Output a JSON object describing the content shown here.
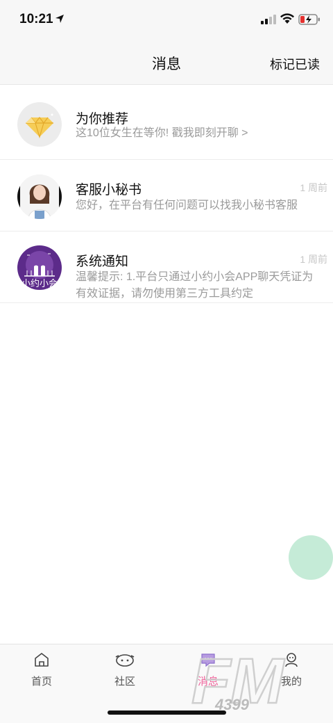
{
  "status_bar": {
    "time": "10:21"
  },
  "nav": {
    "title": "消息",
    "mark_read": "标记已读"
  },
  "messages": [
    {
      "name": "为你推荐",
      "preview": "这10位女生在等你! 戳我即刻开聊 >",
      "time": ""
    },
    {
      "name": "客服小秘书",
      "preview": "您好，在平台有任何问题可以找我小秘书客服",
      "time": "1 周前"
    },
    {
      "name": "系统通知",
      "preview": "温馨提示: 1.平台只通过小约小会APP聊天凭证为有效证据，请勿使用第三方工具约定",
      "time": "1 周前"
    }
  ],
  "system_avatar_text": "小约小会",
  "tabs": [
    {
      "label": "首页",
      "icon": "home-icon"
    },
    {
      "label": "社区",
      "icon": "community-icon"
    },
    {
      "label": "消息",
      "icon": "message-icon",
      "active": true
    },
    {
      "label": "我的",
      "icon": "profile-icon"
    }
  ],
  "watermark": {
    "text": "FM",
    "sub": "4399"
  },
  "colors": {
    "accent": "#f0619a",
    "float_button": "#c5ebd7",
    "muted": "#9a9a9a"
  }
}
